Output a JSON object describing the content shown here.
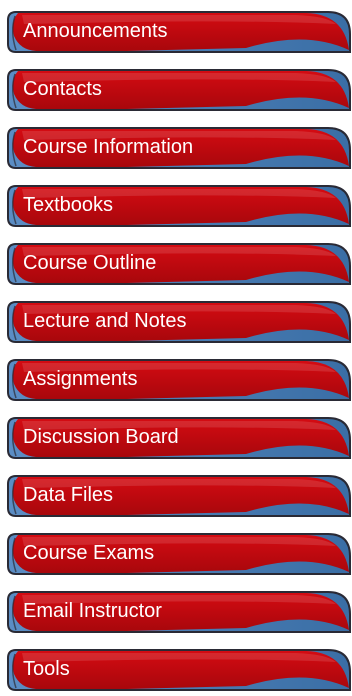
{
  "nav": {
    "items": [
      {
        "label": "Announcements"
      },
      {
        "label": "Contacts"
      },
      {
        "label": "Course Information"
      },
      {
        "label": "Textbooks"
      },
      {
        "label": "Course Outline"
      },
      {
        "label": "Lecture and Notes"
      },
      {
        "label": "Assignments"
      },
      {
        "label": "Discussion Board"
      },
      {
        "label": "Data Files"
      },
      {
        "label": "Course Exams"
      },
      {
        "label": "Email Instructor"
      },
      {
        "label": "Tools"
      }
    ]
  },
  "colors": {
    "button_red": "#d40b12",
    "button_red_dark": "#a8070c",
    "accent_blue": "#3a6ea5",
    "outline": "#2a2a35",
    "label": "#ffffff"
  }
}
